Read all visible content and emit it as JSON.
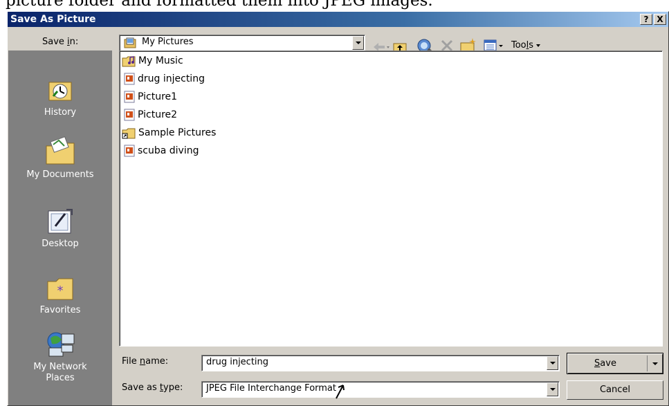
{
  "doc_caption": "picture folder and formatted them into JPEG images.",
  "dialog": {
    "title": "Save As Picture",
    "help_glyph": "?",
    "close_glyph": "X"
  },
  "save_in": {
    "label_pre": "Save ",
    "label_key": "i",
    "label_post": "n:",
    "value": "My Pictures"
  },
  "toolbar": {
    "tools_label_pre": "Too",
    "tools_label_key": "l",
    "tools_label_post": "s",
    "icons": [
      "back-arrow-icon",
      "up-folder-icon",
      "search-web-icon",
      "delete-icon",
      "new-folder-icon",
      "views-icon"
    ]
  },
  "places": [
    {
      "label": "History",
      "icon": "history-icon"
    },
    {
      "label": "My Documents",
      "icon": "my-documents-icon"
    },
    {
      "label": "Desktop",
      "icon": "desktop-icon"
    },
    {
      "label": "Favorites",
      "icon": "favorites-icon"
    },
    {
      "label": "My Network Places",
      "icon": "network-places-icon"
    }
  ],
  "files": [
    {
      "name": "My Music",
      "type": "folder"
    },
    {
      "name": "drug injecting",
      "type": "presentation"
    },
    {
      "name": "Picture1",
      "type": "presentation"
    },
    {
      "name": "Picture2",
      "type": "presentation"
    },
    {
      "name": "Sample Pictures",
      "type": "folder-shortcut"
    },
    {
      "name": "scuba diving",
      "type": "presentation"
    }
  ],
  "filename": {
    "label_pre": "File ",
    "label_key": "n",
    "label_post": "ame:",
    "value": "drug injecting"
  },
  "filetype": {
    "label_pre": "Save as ",
    "label_key": "t",
    "label_post": "ype:",
    "value": "JPEG File Interchange Format"
  },
  "buttons": {
    "save_key": "S",
    "save_rest": "ave",
    "cancel": "Cancel"
  }
}
